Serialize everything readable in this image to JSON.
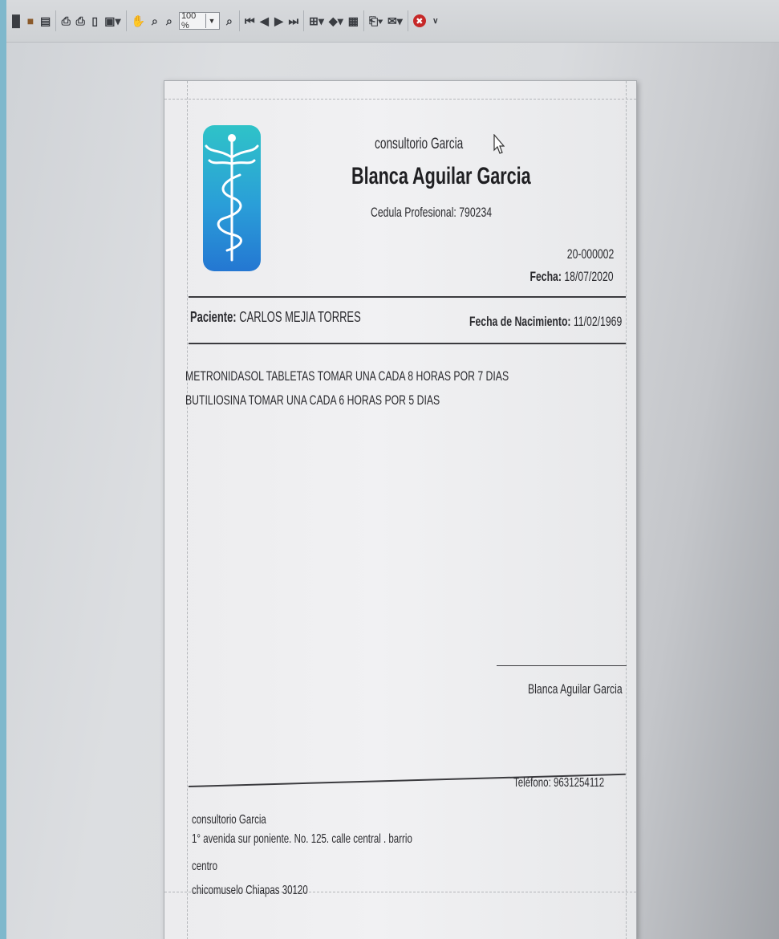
{
  "toolbar": {
    "zoom_value": "100 %",
    "icons": [
      "find-icon",
      "open-icon",
      "page-icon",
      "print-icon",
      "print-preview-icon",
      "page-setup-icon",
      "export-icon",
      "hand-icon",
      "zoom-in-icon",
      "zoom-out-icon",
      "zoom-fit-icon",
      "first-page-icon",
      "prev-page-icon",
      "next-page-icon",
      "last-page-icon",
      "multi-page-icon",
      "highlight-icon",
      "document-icon",
      "export-file-icon",
      "email-icon",
      "close-preview-icon"
    ]
  },
  "document": {
    "clinic_name": "consultorio Garcia",
    "doctor_name": "Blanca Aguilar Garcia",
    "cedula": "Cedula Profesional: 790234",
    "folio": "20-000002",
    "fecha_label": "Fecha:",
    "fecha_value": " 18/07/2020",
    "paciente_label": "Paciente:",
    "paciente_value": " CARLOS MEJIA TORRES",
    "nacimiento_label": "Fecha de Nacimiento:",
    "nacimiento_value": " 11/02/1969",
    "prescription": [
      "METRONIDASOL TABLETAS TOMAR UNA CADA 8 HORAS POR 7 DIAS",
      "BUTILIOSINA TOMAR UNA CADA 6 HORAS POR 5 DIAS"
    ],
    "signature_name": "Blanca Aguilar Garcia",
    "telefono": "Teléfono: 9631254112",
    "footer": {
      "clinic": "consultorio Garcia",
      "address1": "1° avenida sur poniente. No. 125. calle central . barrio",
      "address2": "centro",
      "city": "chicomuselo Chiapas 30120"
    }
  },
  "colors": {
    "logo_top": "#2fc3c8",
    "logo_bottom": "#2477d2",
    "close_button": "#c62828"
  }
}
